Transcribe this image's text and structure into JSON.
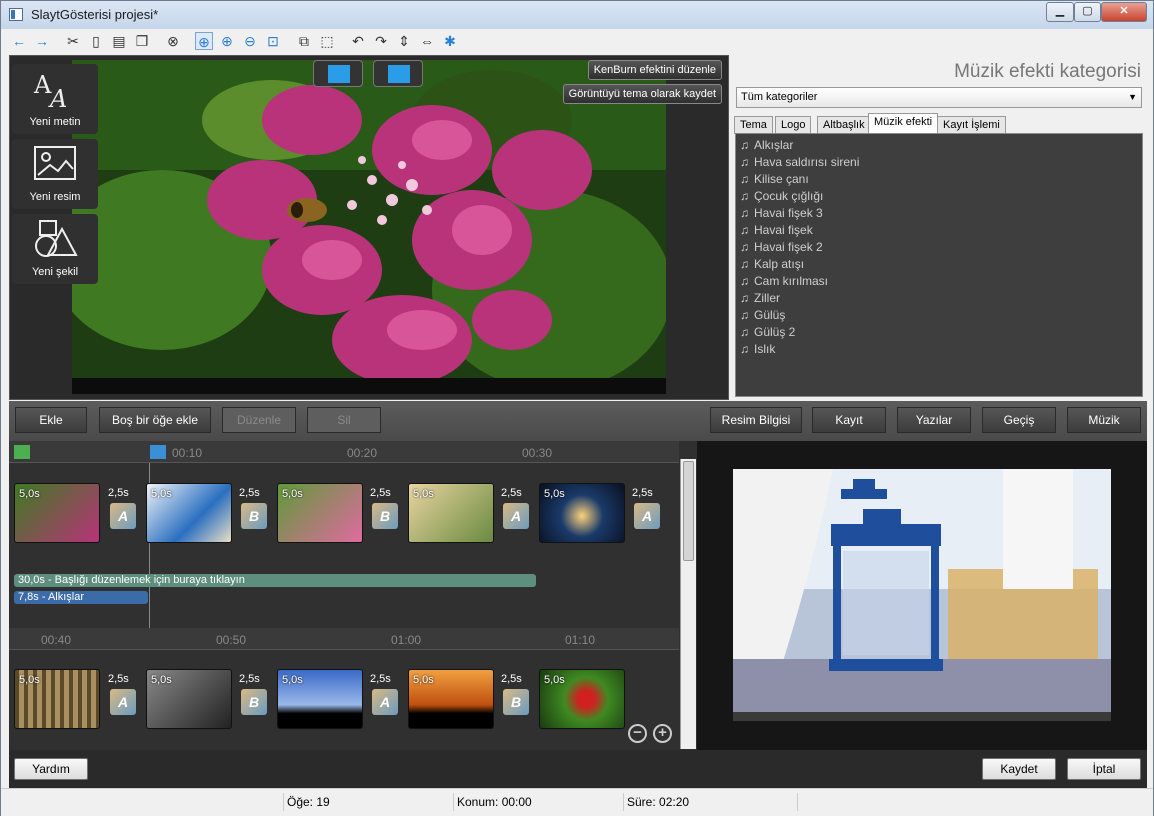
{
  "window": {
    "title": "SlaytGösterisi projesi*"
  },
  "toolbar": {
    "icons": [
      "back-arrow-icon",
      "forward-arrow-icon",
      "cut-icon",
      "copy-icon",
      "paste-icon",
      "duplicate-icon",
      "delete-icon",
      "zoom-fit-icon",
      "zoom-in-icon",
      "zoom-out-icon",
      "zoom-select-icon",
      "crop-icon",
      "resize-icon",
      "rotate-left-icon",
      "rotate-right-icon",
      "flip-vertical-icon",
      "flip-horizontal-icon",
      "settings-icon"
    ]
  },
  "tools": {
    "new_text": "Yeni metin",
    "new_image": "Yeni resim",
    "new_shape": "Yeni şekil"
  },
  "preview": {
    "kenburns_label": "KenBurn efektini düzenle",
    "save_theme_label": "Görüntüyü tema olarak kaydet"
  },
  "category_panel": {
    "title": "Müzik efekti kategorisi",
    "selected_category": "Tüm kategoriler",
    "tabs": [
      "Tema",
      "Logo",
      "Altbaşlık",
      "Müzik efekti",
      "Kayıt İşlemi"
    ],
    "active_tab": "Müzik efekti",
    "effects": [
      "Alkışlar",
      "Hava saldırısı sireni",
      "Kilise çanı",
      "Çocuk çığlığı",
      "Havai fişek 3",
      "Havai fişek",
      "Havai fişek 2",
      "Kalp atışı",
      "Cam kırılması",
      "Ziller",
      "Gülüş",
      "Gülüş 2",
      "Islık"
    ]
  },
  "action_bar": {
    "add": "Ekle",
    "add_empty": "Boş bir öğe ekle",
    "edit": "Düzenle",
    "delete": "Sil",
    "image_info": "Resim Bilgisi",
    "record": "Kayıt",
    "texts": "Yazılar",
    "transition": "Geçiş",
    "music": "Müzik"
  },
  "timeline": {
    "ruler1": [
      "00:10",
      "00:20",
      "00:30"
    ],
    "ruler2": [
      "00:40",
      "00:50",
      "01:00",
      "01:10"
    ],
    "clip_duration": "5,0s",
    "transition_duration": "2,5s",
    "title_bar": "30,0s - Başlığı düzenlemek için buraya tıklayın",
    "audio_bar": "7,8s - Alkışlar"
  },
  "footer": {
    "help": "Yardım",
    "save": "Kaydet",
    "cancel": "İptal"
  },
  "status": {
    "items": "Öğe: 19",
    "position": "Konum: 00:00",
    "duration": "Süre: 02:20"
  }
}
